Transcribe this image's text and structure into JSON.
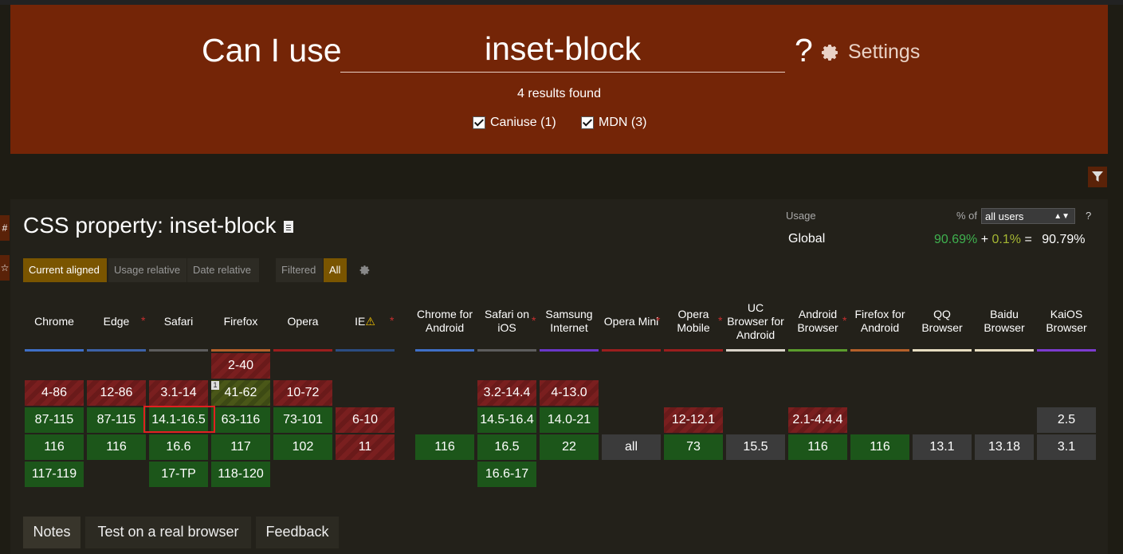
{
  "header": {
    "prefix": "Can I use",
    "query": "inset-block",
    "suffix": "?",
    "settings_label": "Settings",
    "results": "4 results found",
    "filters": [
      {
        "label": "Caniuse (1)",
        "checked": true
      },
      {
        "label": "MDN (3)",
        "checked": true
      }
    ]
  },
  "feature": {
    "title": "CSS property: inset-block",
    "usage_label": "Usage",
    "global_label": "Global",
    "pct_of_label": "% of",
    "users_select": "all users",
    "help": "?",
    "supported": "90.69%",
    "plus": "+",
    "partial": "0.1%",
    "equals": "=",
    "total": "90.79%"
  },
  "view_modes": [
    "Current aligned",
    "Usage relative",
    "Date relative"
  ],
  "filter_modes": [
    "Filtered",
    "All"
  ],
  "browsers": [
    {
      "name": "Chrome",
      "color": "#3f6fc6"
    },
    {
      "name": "Edge",
      "color": "#3d62a8",
      "star": true
    },
    {
      "name": "Safari",
      "color": "#5d5d5d"
    },
    {
      "name": "Firefox",
      "color": "#b5602a"
    },
    {
      "name": "Opera",
      "color": "#9b1e1e"
    },
    {
      "name": "IE",
      "color": "#2b4d82",
      "star": true,
      "warn": true
    },
    {
      "name": "Chrome for Android",
      "color": "#3f6fc6"
    },
    {
      "name": "Safari on iOS",
      "color": "#5d5d5d",
      "star": true
    },
    {
      "name": "Samsung Internet",
      "color": "#6a37c9"
    },
    {
      "name": "Opera Mini",
      "color": "#9b1e1e",
      "star": true
    },
    {
      "name": "Opera Mobile",
      "color": "#9b1e1e",
      "star": true
    },
    {
      "name": "UC Browser for Android",
      "color": "#d9d3c8"
    },
    {
      "name": "Android Browser",
      "color": "#5b9d2d",
      "star": true
    },
    {
      "name": "Firefox for Android",
      "color": "#b5602a"
    },
    {
      "name": "QQ Browser",
      "color": "#e6dcc0"
    },
    {
      "name": "Baidu Browser",
      "color": "#e6dcc0"
    },
    {
      "name": "KaiOS Browser",
      "color": "#7c3bd0"
    }
  ],
  "cells": {
    "chrome": [
      "4-86",
      "87-115",
      "116",
      "117-119"
    ],
    "edge": [
      "12-86",
      "87-115",
      "116"
    ],
    "safari": [
      "3.1-14",
      "14.1-16.5",
      "16.6",
      "17-TP"
    ],
    "firefox": [
      "2-40",
      "41-62",
      "63-116",
      "117",
      "118-120"
    ],
    "opera": [
      "10-72",
      "73-101",
      "102"
    ],
    "ie": [
      "6-10",
      "11"
    ],
    "chrome_android": [
      "116"
    ],
    "safari_ios": [
      "3.2-14.4",
      "14.5-16.4",
      "16.5",
      "16.6-17"
    ],
    "samsung": [
      "4-13.0",
      "14.0-21",
      "22"
    ],
    "opera_mini": [
      "all"
    ],
    "opera_mobile": [
      "12-12.1",
      "73"
    ],
    "uc": [
      "15.5"
    ],
    "android": [
      "2.1-4.4.4",
      "116"
    ],
    "firefox_android": [
      "116"
    ],
    "qq": [
      "13.1"
    ],
    "baidu": [
      "13.18"
    ],
    "kaios": [
      "2.5",
      "3.1"
    ]
  },
  "note_badge": "1",
  "tabs": [
    "Notes",
    "Test on a real browser",
    "Feedback"
  ],
  "side_tabs": [
    "#",
    "☆"
  ]
}
